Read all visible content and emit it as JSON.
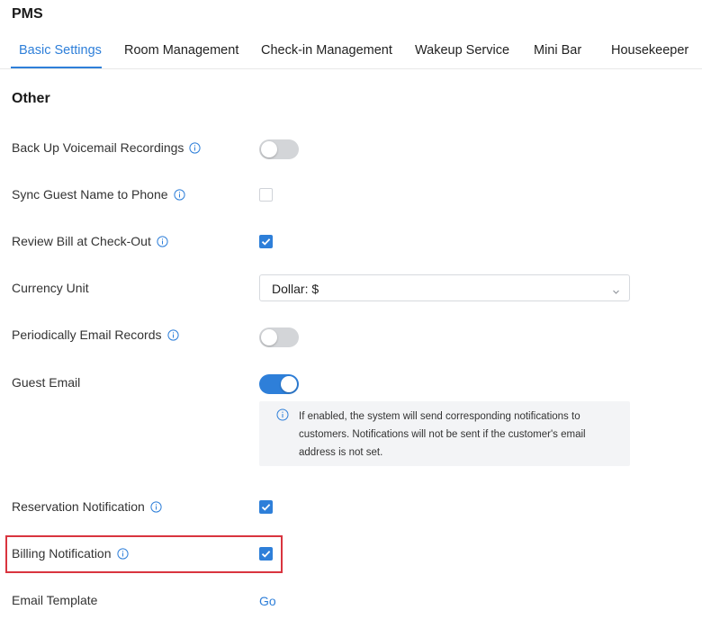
{
  "app": {
    "title": "PMS"
  },
  "tabs": [
    {
      "label": "Basic Settings",
      "active": true
    },
    {
      "label": "Room Management",
      "active": false
    },
    {
      "label": "Check-in Management",
      "active": false
    },
    {
      "label": "Wakeup Service",
      "active": false
    },
    {
      "label": "Mini Bar",
      "active": false
    },
    {
      "label": "Housekeeper",
      "active": false
    }
  ],
  "section": {
    "title": "Other"
  },
  "settings": {
    "backup_voicemail": {
      "label": "Back Up Voicemail Recordings",
      "control": "toggle",
      "enabled": false,
      "has_info": true
    },
    "sync_guest_name": {
      "label": "Sync Guest Name to Phone",
      "control": "checkbox",
      "checked": false,
      "has_info": true
    },
    "review_bill": {
      "label": "Review Bill at Check-Out",
      "control": "checkbox",
      "checked": true,
      "has_info": true
    },
    "currency_unit": {
      "label": "Currency Unit",
      "control": "select",
      "value": "Dollar: $"
    },
    "periodic_email": {
      "label": "Periodically Email Records",
      "control": "toggle",
      "enabled": false,
      "has_info": true
    },
    "guest_email": {
      "label": "Guest Email",
      "control": "toggle",
      "enabled": true,
      "info_text": "If enabled, the system will send corresponding notifications to customers. Notifications will not be sent if the customer's email address is not set."
    },
    "reservation_notification": {
      "label": "Reservation Notification",
      "control": "checkbox",
      "checked": true,
      "has_info": true
    },
    "billing_notification": {
      "label": "Billing Notification",
      "control": "checkbox",
      "checked": true,
      "has_info": true,
      "highlighted": true
    },
    "email_template": {
      "label": "Email Template",
      "control": "link",
      "link_label": "Go"
    }
  },
  "icons": {
    "info": "info-circle-icon",
    "check": "checkmark-icon",
    "dropdown": "chevron-down-icon"
  },
  "colors": {
    "accent": "#2e7fd9",
    "toggle_off": "#d3d5d8",
    "highlight_border": "#d9343f",
    "info_box_bg": "#f3f4f6"
  }
}
